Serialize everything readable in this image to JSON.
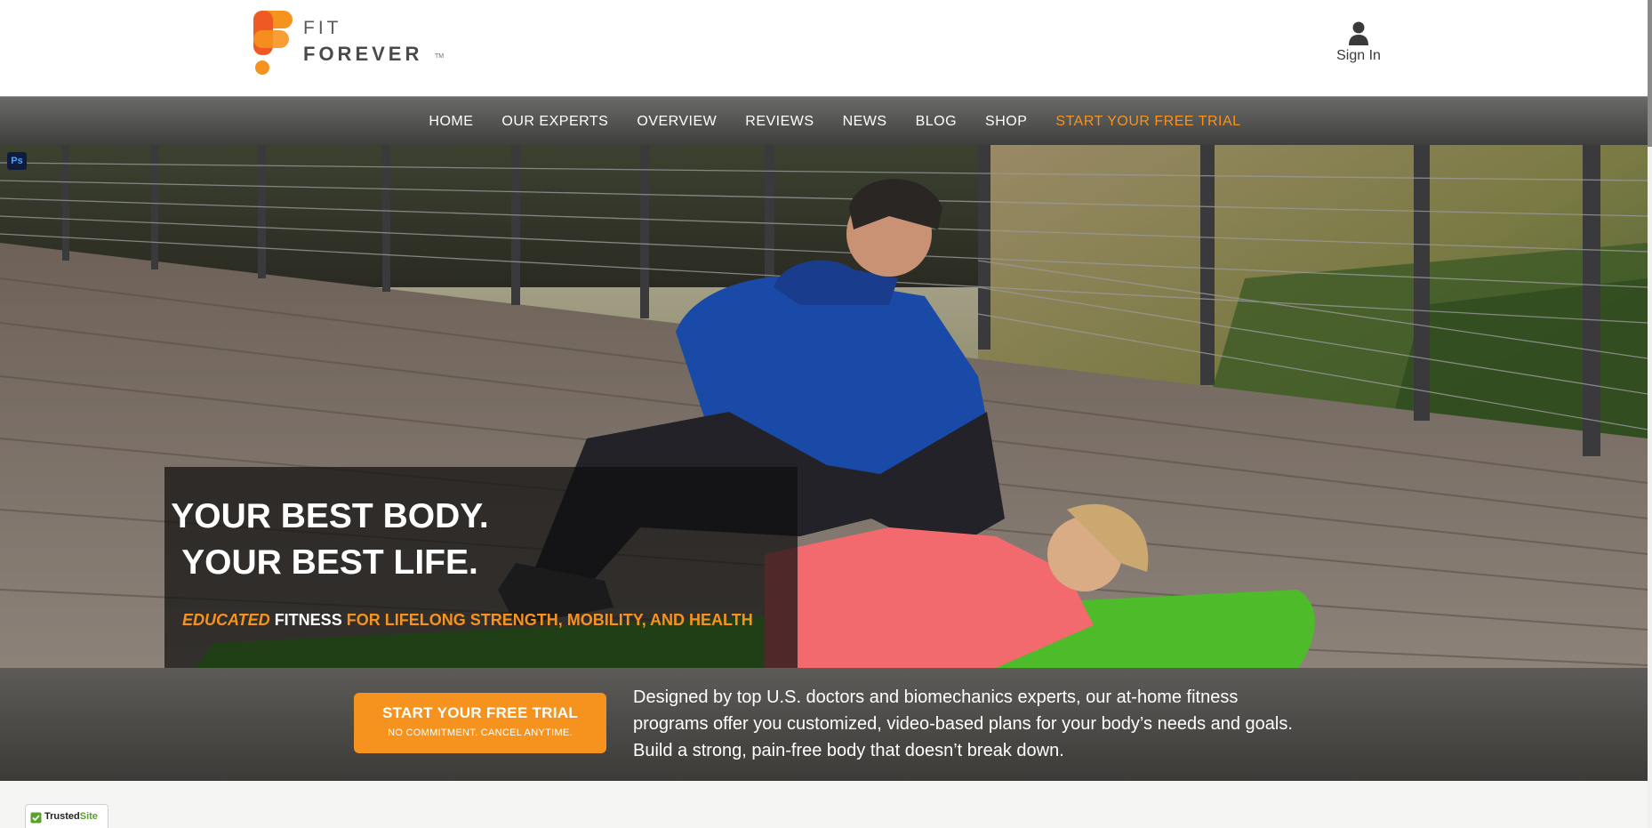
{
  "brand": {
    "fit": "FIT",
    "forever": "FOREVER",
    "tm": "TM"
  },
  "header": {
    "signin_label": "Sign In"
  },
  "nav": {
    "items": [
      "HOME",
      "OUR EXPERTS",
      "OVERVIEW",
      "REVIEWS",
      "NEWS",
      "BLOG",
      "SHOP"
    ],
    "trial": "START YOUR FREE TRIAL"
  },
  "hero": {
    "ps_badge": "Ps",
    "title_line1": "YOUR BEST BODY.",
    "title_line2": "YOUR BEST LIFE.",
    "sub_em": "EDUCATED",
    "sub_white": "FITNESS",
    "sub_rest": "FOR LIFELONG STRENGTH, MOBILITY, AND HEALTH"
  },
  "promo": {
    "cta_title": "START YOUR FREE TRIAL",
    "cta_sub": "NO COMMITMENT. CANCEL ANYTIME.",
    "description": "Designed by top U.S. doctors and biomechanics experts, our at-home fitness programs offer you customized, video-based plans for your body’s needs and goals. Build a strong, pain-free body that doesn’t break down."
  },
  "trust": {
    "trusted": "Trusted",
    "site": "Site"
  },
  "colors": {
    "accent": "#f6931f",
    "nav_bg": "#4f4f4d",
    "band_bg": "#4a4946"
  }
}
